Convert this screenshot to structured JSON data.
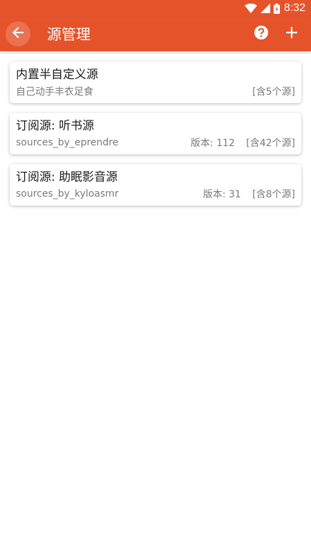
{
  "status_bar": {
    "time": "8:32"
  },
  "toolbar": {
    "title": "源管理",
    "back_icon": "arrow-left-icon",
    "help_icon": "help-circle-icon",
    "add_icon": "plus-icon"
  },
  "colors": {
    "primary": "#e5532b",
    "text": "#1a1a1a",
    "secondary_text": "#7a7a7a"
  },
  "sources": [
    {
      "title": "内置半自定义源",
      "subtitle": "自己动手丰衣足食",
      "version": "",
      "count": "[含5个源]"
    },
    {
      "title": "订阅源: 听书源",
      "subtitle": "sources_by_eprendre",
      "version": "版本: 112",
      "count": "[含42个源]"
    },
    {
      "title": "订阅源: 助眠影音源",
      "subtitle": "sources_by_kyloasmr",
      "version": "版本: 31",
      "count": "[含8个源]"
    }
  ]
}
